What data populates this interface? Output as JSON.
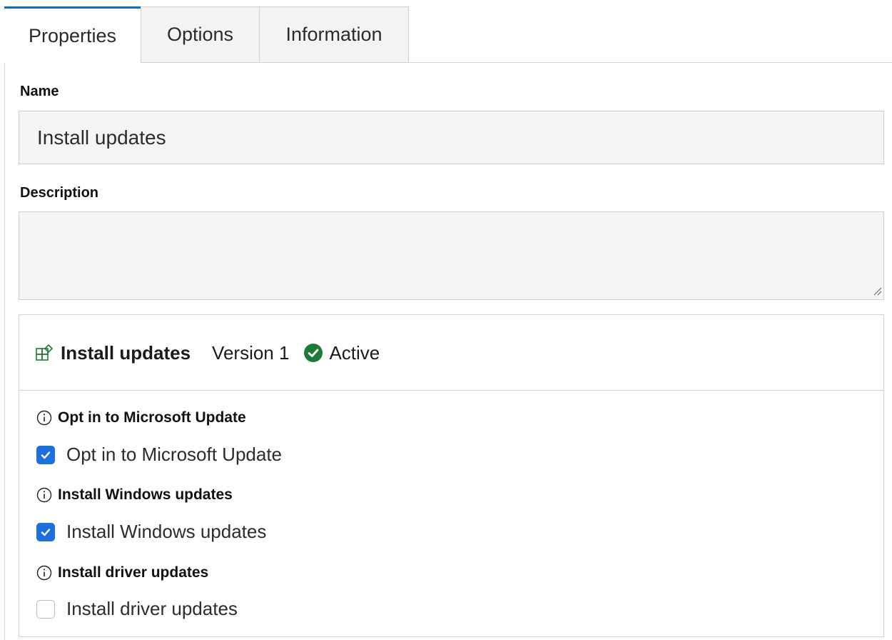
{
  "tabs": [
    {
      "label": "Properties",
      "active": true
    },
    {
      "label": "Options",
      "active": false
    },
    {
      "label": "Information",
      "active": false
    }
  ],
  "form": {
    "name_label": "Name",
    "name_value": "Install updates",
    "description_label": "Description",
    "description_value": ""
  },
  "card": {
    "icon": "windows-update-icon",
    "title": "Install updates",
    "version": "Version 1",
    "status": "Active",
    "status_color": "#1f7a3a",
    "sections": [
      {
        "label": "Opt in to Microsoft Update",
        "checkbox_label": "Opt in to Microsoft Update",
        "checked": true
      },
      {
        "label": "Install Windows updates",
        "checkbox_label": "Install Windows updates",
        "checked": true
      },
      {
        "label": "Install driver updates",
        "checkbox_label": "Install driver updates",
        "checked": false
      }
    ]
  },
  "colors": {
    "accent": "#0f6cbd",
    "checkbox": "#1e6fd9",
    "icon_green": "#1f7a3a"
  }
}
